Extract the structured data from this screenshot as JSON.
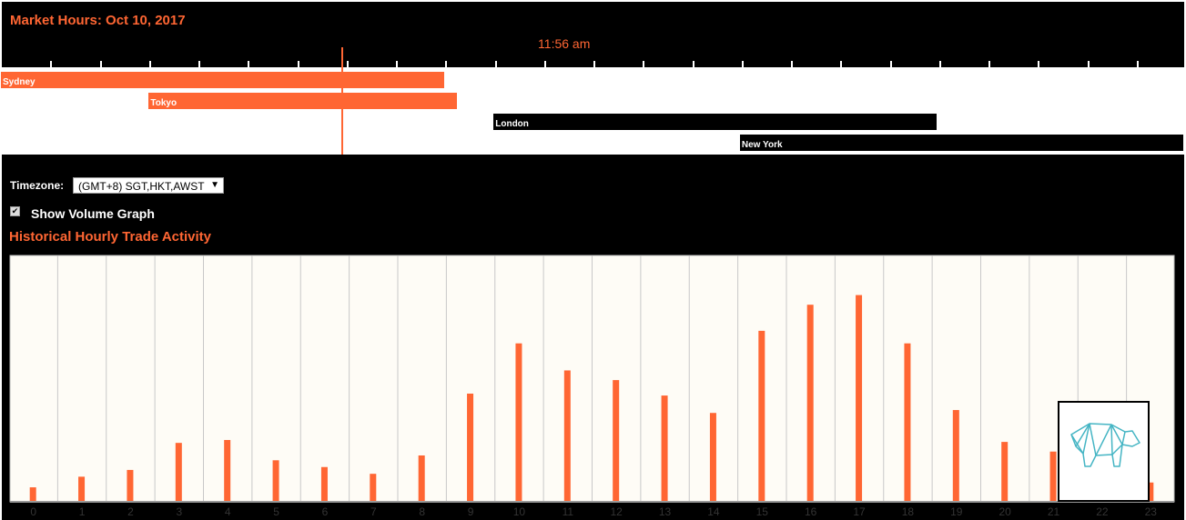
{
  "header": {
    "title": "Market Hours: Oct 10, 2017",
    "current_time": "11:56 am",
    "current_hour": 11.93
  },
  "markets": [
    {
      "name": "Sydney",
      "start": 0,
      "end": 9,
      "color": "#ff6633"
    },
    {
      "name": "Tokyo",
      "start": 3,
      "end": 9.25,
      "color": "#ff6633"
    },
    {
      "name": "London",
      "start": 10,
      "end": 19,
      "color": "#000000"
    },
    {
      "name": "New York",
      "start": 15,
      "end": 24,
      "color": "#000000"
    }
  ],
  "controls": {
    "timezone_label": "Timezone:",
    "timezone_value": "(GMT+8) SGT,HKT,AWST",
    "volume_checkbox_label": "Show Volume Graph",
    "volume_checked": true
  },
  "chart_heading": "Historical Hourly Trade Activity",
  "chart_data": {
    "type": "bar",
    "categories": [
      "0",
      "1",
      "2",
      "3",
      "4",
      "5",
      "6",
      "7",
      "8",
      "9",
      "10",
      "11",
      "12",
      "13",
      "14",
      "15",
      "16",
      "17",
      "18",
      "19",
      "20",
      "21",
      "22",
      "23"
    ],
    "values": [
      15,
      26,
      33,
      61,
      64,
      43,
      36,
      29,
      48,
      112,
      164,
      136,
      126,
      110,
      92,
      177,
      204,
      214,
      164,
      95,
      62,
      52,
      3,
      20
    ],
    "ylim": [
      0,
      255
    ],
    "grid": true,
    "bar_color": "#ff6633",
    "background": "#fefcf6"
  },
  "logo": {
    "icon": "geometric-bear-icon",
    "color": "#45b5c4"
  }
}
